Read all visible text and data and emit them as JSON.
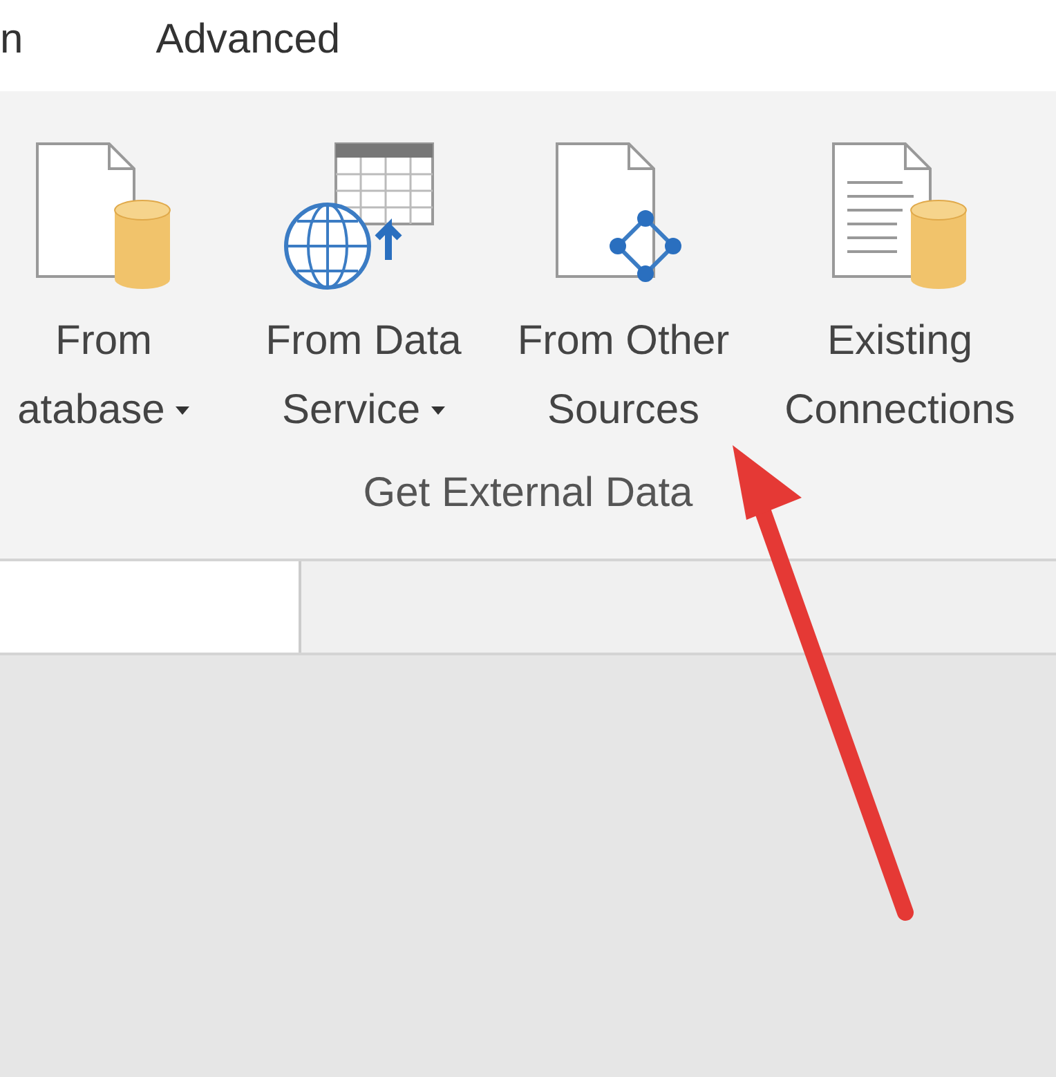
{
  "tabs": [
    {
      "label": "n",
      "selected": false
    },
    {
      "label": "Advanced",
      "selected": false
    }
  ],
  "ribbon": {
    "group_label": "Get External Data",
    "buttons": [
      {
        "kind": "database",
        "lines": [
          "From",
          "atabase"
        ],
        "dropdown": true
      },
      {
        "kind": "data-service",
        "lines": [
          "From Data",
          "Service"
        ],
        "dropdown": true
      },
      {
        "kind": "other-sources",
        "lines": [
          "From Other",
          "Sources"
        ],
        "dropdown": false
      },
      {
        "kind": "existing",
        "lines": [
          "Existing",
          "Connections"
        ],
        "dropdown": false
      }
    ]
  }
}
